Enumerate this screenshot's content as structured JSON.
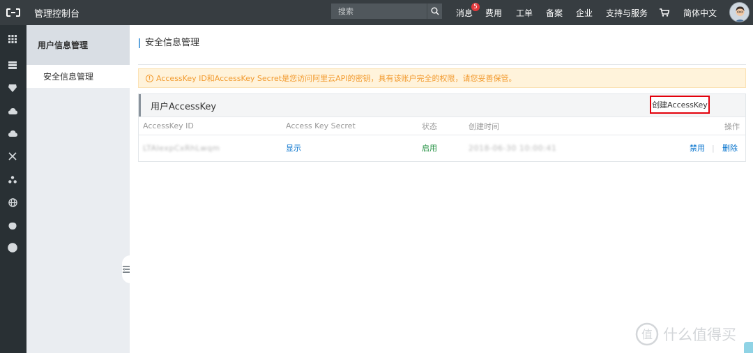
{
  "topbar": {
    "console_title": "管理控制台",
    "search_placeholder": "搜索",
    "messages_label": "消息",
    "messages_count": "5",
    "billing_label": "费用",
    "tickets_label": "工单",
    "icp_label": "备案",
    "enterprise_label": "企业",
    "support_label": "支持与服务",
    "language_label": "简体中文"
  },
  "sidebar": {
    "header": "用户信息管理",
    "items": [
      {
        "label": "安全信息管理"
      }
    ]
  },
  "main": {
    "page_title": "安全信息管理",
    "notice": "AccessKey ID和AccessKey Secret是您访问阿里云API的密钥，具有该账户完全的权限，请您妥善保管。",
    "panel_title": "用户AccessKey",
    "create_button": "创建AccessKey",
    "columns": [
      "AccessKey ID",
      "Access Key Secret",
      "状态",
      "创建时间",
      "操作"
    ],
    "rows": [
      {
        "access_key_id": "LTAIexpCxRhLwqm",
        "secret_action": "显示",
        "status": "启用",
        "created": "2018-06-30 10:00:41",
        "disable_action": "禁用",
        "delete_action": "删除"
      }
    ]
  },
  "watermark": "什么值得买",
  "colors": {
    "topbar": "#373d41",
    "rail": "#293034",
    "accent_link": "#0070cc",
    "status_ok": "#1e8e3e",
    "notice_text": "#f29a2e",
    "highlight_border": "#e3000b"
  }
}
